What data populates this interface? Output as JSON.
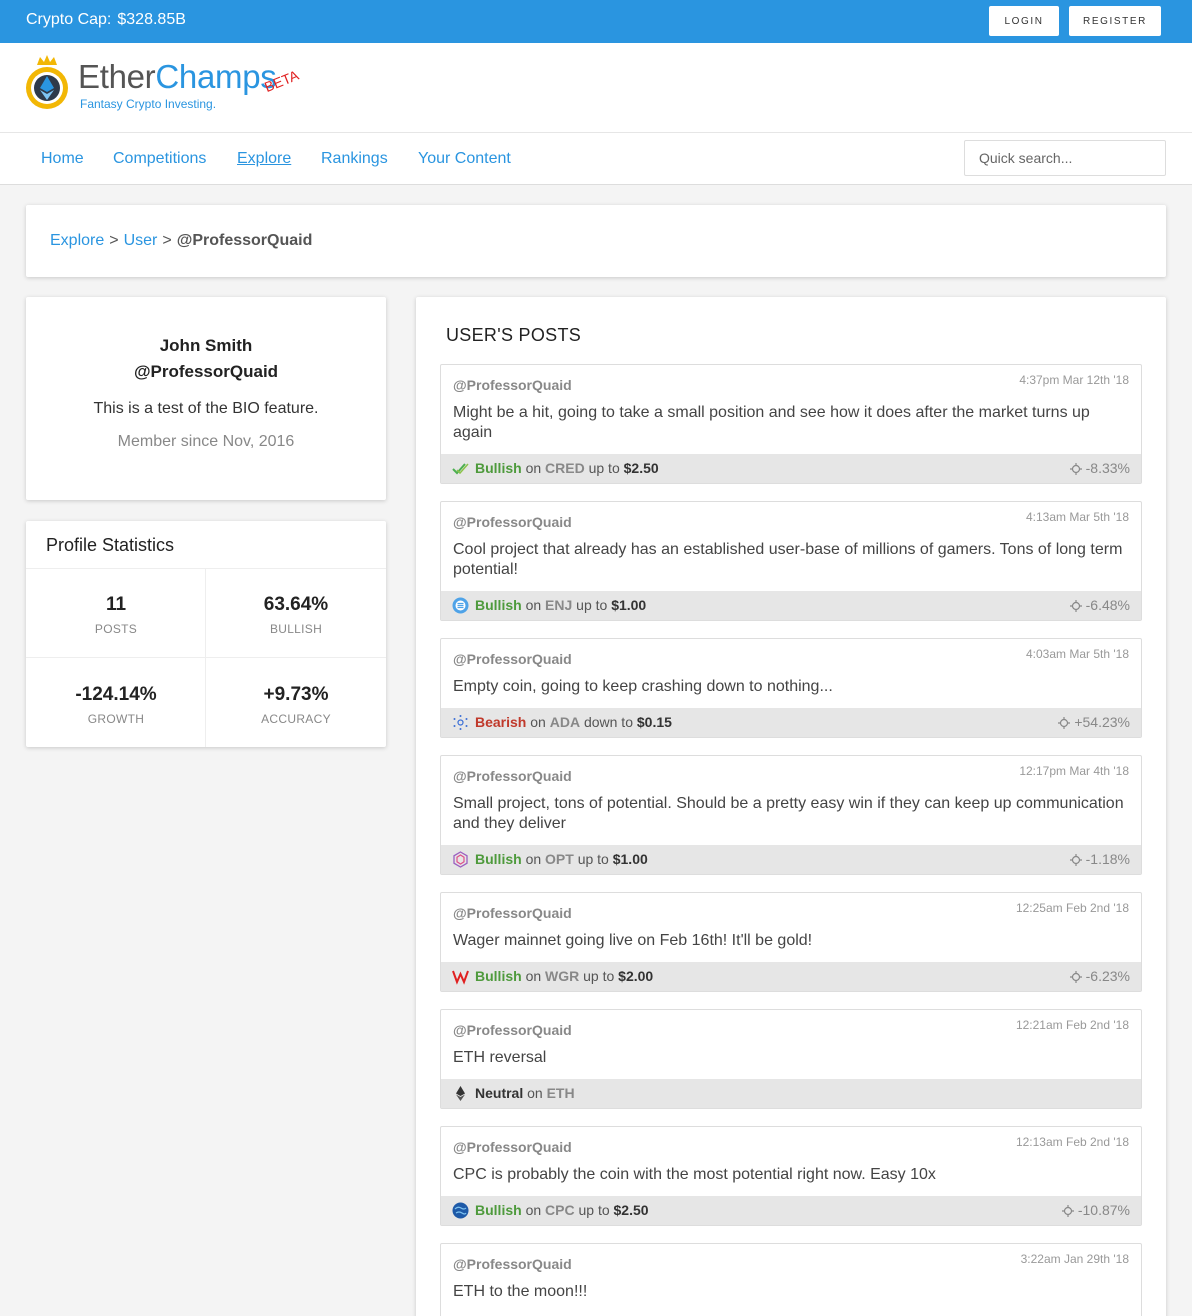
{
  "topbar": {
    "crypto_cap_label": "Crypto Cap:",
    "crypto_cap_value": "$328.85B",
    "login_label": "LOGIN",
    "register_label": "REGISTER"
  },
  "brand": {
    "name_part1": "Ether",
    "name_part2": "Champs",
    "tagline": "Fantasy Crypto Investing.",
    "badge": "BETA"
  },
  "nav": {
    "items": [
      "Home",
      "Competitions",
      "Explore",
      "Rankings",
      "Your Content"
    ],
    "active": "Explore",
    "search_placeholder": "Quick search..."
  },
  "breadcrumb": {
    "items": [
      "Explore",
      "User"
    ],
    "separator": ">",
    "current": "@ProfessorQuaid"
  },
  "profile": {
    "name": "John Smith",
    "handle": "@ProfessorQuaid",
    "bio": "This is a test of the BIO feature.",
    "member_since": "Member since Nov, 2016"
  },
  "stats": {
    "title": "Profile Statistics",
    "items": [
      {
        "value": "11",
        "label": "POSTS"
      },
      {
        "value": "63.64%",
        "label": "BULLISH"
      },
      {
        "value": "-124.14%",
        "label": "GROWTH"
      },
      {
        "value": "+9.73%",
        "label": "ACCURACY"
      }
    ]
  },
  "posts": {
    "heading": "USER'S POSTS",
    "colors": {
      "bullish": "#4e9a3c",
      "bearish": "#c0392b",
      "neutral": "#333333"
    },
    "items": [
      {
        "author": "@ProfessorQuaid",
        "time": "4:37pm Mar 12th '18",
        "body": "Might be a hit, going to take a small position and see how it does after the market turns up again",
        "sentiment": "Bullish",
        "on": "on",
        "coin": "CRED",
        "direction": "up to",
        "target": "$2.50",
        "accuracy": "-8.33%",
        "icon": "cred-coin-icon"
      },
      {
        "author": "@ProfessorQuaid",
        "time": "4:13am Mar 5th '18",
        "body": "Cool project that already has an established user-base of millions of gamers. Tons of long term potential!",
        "sentiment": "Bullish",
        "on": "on",
        "coin": "ENJ",
        "direction": "up to",
        "target": "$1.00",
        "accuracy": "-6.48%",
        "icon": "enj-coin-icon"
      },
      {
        "author": "@ProfessorQuaid",
        "time": "4:03am Mar 5th '18",
        "body": "Empty coin, going to keep crashing down to nothing...",
        "sentiment": "Bearish",
        "on": "on",
        "coin": "ADA",
        "direction": "down to",
        "target": "$0.15",
        "accuracy": "+54.23%",
        "icon": "ada-coin-icon"
      },
      {
        "author": "@ProfessorQuaid",
        "time": "12:17pm Mar 4th '18",
        "body": "Small project, tons of potential. Should be a pretty easy win if they can keep up communication and they deliver",
        "sentiment": "Bullish",
        "on": "on",
        "coin": "OPT",
        "direction": "up to",
        "target": "$1.00",
        "accuracy": "-1.18%",
        "icon": "opt-coin-icon"
      },
      {
        "author": "@ProfessorQuaid",
        "time": "12:25am Feb 2nd '18",
        "body": "Wager mainnet going live on Feb 16th! It'll be gold!",
        "sentiment": "Bullish",
        "on": "on",
        "coin": "WGR",
        "direction": "up to",
        "target": "$2.00",
        "accuracy": "-6.23%",
        "icon": "wgr-coin-icon"
      },
      {
        "author": "@ProfessorQuaid",
        "time": "12:21am Feb 2nd '18",
        "body": "ETH reversal",
        "sentiment": "Neutral",
        "on": "on",
        "coin": "ETH",
        "direction": "",
        "target": "",
        "accuracy": "",
        "icon": "eth-coin-icon"
      },
      {
        "author": "@ProfessorQuaid",
        "time": "12:13am Feb 2nd '18",
        "body": "CPC is probably the coin with the most potential right now. Easy 10x",
        "sentiment": "Bullish",
        "on": "on",
        "coin": "CPC",
        "direction": "up to",
        "target": "$2.50",
        "accuracy": "-10.87%",
        "icon": "cpc-coin-icon"
      },
      {
        "author": "@ProfessorQuaid",
        "time": "3:22am Jan 29th '18",
        "body": "ETH to the moon!!!",
        "sentiment": "",
        "on": "",
        "coin": "",
        "direction": "",
        "target": "",
        "accuracy": "",
        "icon": ""
      }
    ]
  }
}
